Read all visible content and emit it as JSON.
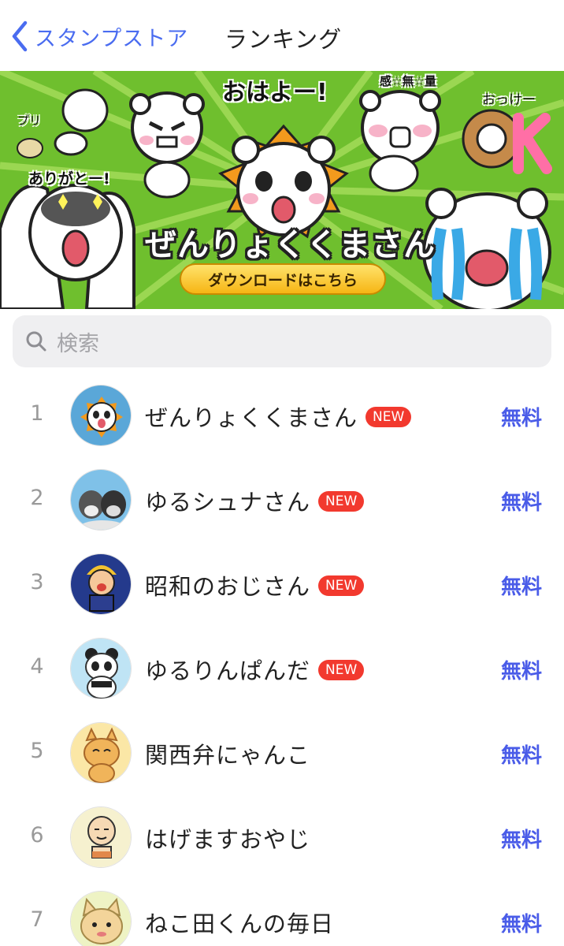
{
  "nav": {
    "back_label": "スタンプストア",
    "title": "ランキング"
  },
  "banner": {
    "title": "ぜんりょくくまさん",
    "cta": "ダウンロードはこちら",
    "captions": {
      "ohayo": "おはよー!",
      "arigato": "ありがとー!",
      "kanmuryo": "感☆無☆量",
      "okke": "おっけー",
      "k": "K",
      "puri": "プリ"
    }
  },
  "search": {
    "placeholder": "検索"
  },
  "ranking": [
    {
      "rank": "1",
      "name": "ぜんりょくくまさん",
      "badge": "NEW",
      "price": "無料",
      "thumb_color": "#5aa7d8"
    },
    {
      "rank": "2",
      "name": "ゆるシュナさん",
      "badge": "NEW",
      "price": "無料",
      "thumb_color": "#7fc1e8"
    },
    {
      "rank": "3",
      "name": "昭和のおじさん",
      "badge": "NEW",
      "price": "無料",
      "thumb_color": "#243a8c"
    },
    {
      "rank": "4",
      "name": "ゆるりんぱんだ",
      "badge": "NEW",
      "price": "無料",
      "thumb_color": "#bfe4f5"
    },
    {
      "rank": "5",
      "name": "関西弁にゃんこ",
      "badge": "",
      "price": "無料",
      "thumb_color": "#fbe7a6"
    },
    {
      "rank": "6",
      "name": "はげますおやじ",
      "badge": "",
      "price": "無料",
      "thumb_color": "#f6f1cf"
    },
    {
      "rank": "7",
      "name": "ねこ田くんの毎日",
      "badge": "",
      "price": "無料",
      "thumb_color": "#eef3c4"
    }
  ],
  "colors": {
    "accent": "#4a6cf0",
    "price": "#4a5ce8",
    "badge": "#f2392e",
    "banner_green": "#6fbf2e"
  }
}
